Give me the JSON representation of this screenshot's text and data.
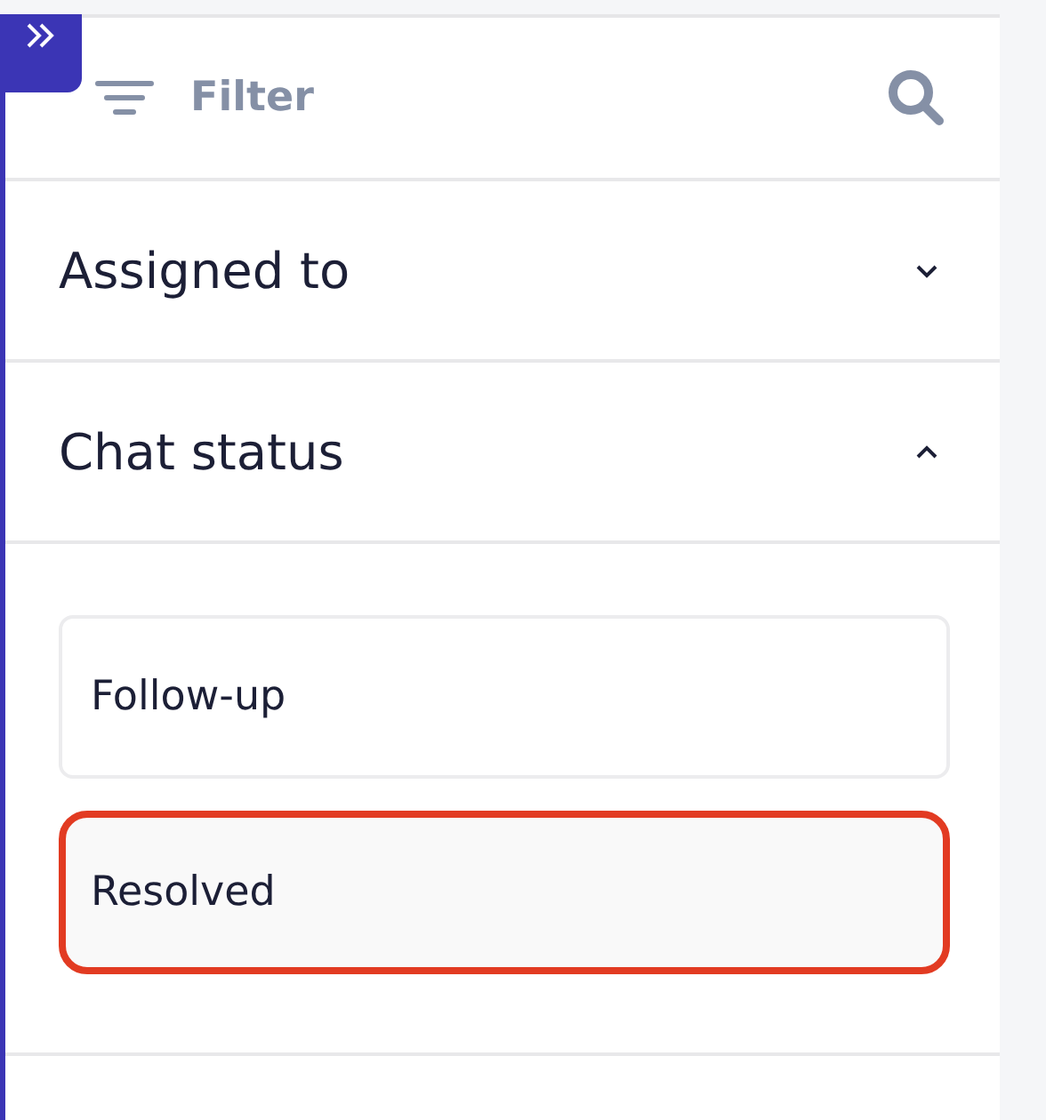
{
  "filter_bar": {
    "label": "Filter"
  },
  "sections": [
    {
      "title": "Assigned to",
      "expanded": false
    },
    {
      "title": "Chat status",
      "expanded": true,
      "options": [
        {
          "label": "Follow-up",
          "selected": false
        },
        {
          "label": "Resolved",
          "selected": true
        }
      ]
    }
  ]
}
